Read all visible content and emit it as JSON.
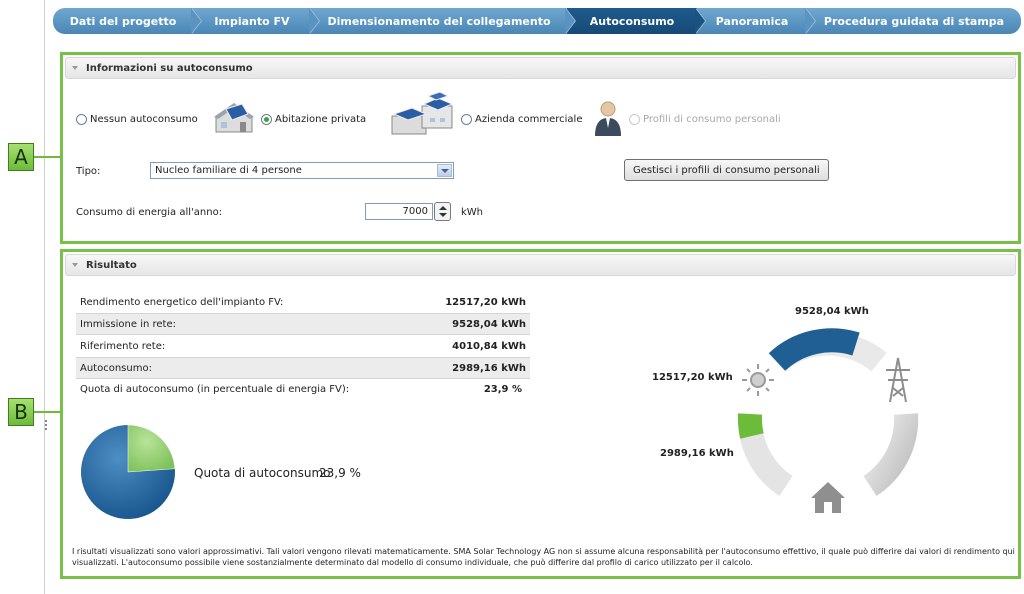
{
  "wizard": {
    "steps": [
      {
        "label": "Dati del progetto"
      },
      {
        "label": "Impianto FV"
      },
      {
        "label": "Dimensionamento del collegamento"
      },
      {
        "label": "Autoconsumo"
      },
      {
        "label": "Panoramica"
      },
      {
        "label": "Procedura guidata di stampa"
      }
    ],
    "active_index": 3
  },
  "callouts": {
    "a": "A",
    "b": "B"
  },
  "info_panel": {
    "title": "Informazioni su autoconsumo",
    "options": {
      "none": "Nessun autoconsumo",
      "private": "Abitazione privata",
      "commercial": "Azienda commerciale",
      "personal": "Profili di consumo personali"
    },
    "selected": "private",
    "tipo_label": "Tipo:",
    "tipo_value": "Nucleo familiare di 4 persone",
    "manage_button": "Gestisci i profili di consumo personali",
    "consumption_label": "Consumo di energia all'anno:",
    "consumption_value": "7000",
    "consumption_unit": "kWh"
  },
  "result_panel": {
    "title": "Risultato",
    "rows": [
      {
        "label": "Rendimento energetico dell'impianto FV:",
        "value": "12517,20 kWh"
      },
      {
        "label": "Immissione in rete:",
        "value": "9528,04 kWh"
      },
      {
        "label": "Riferimento rete:",
        "value": "4010,84 kWh"
      },
      {
        "label": "Autoconsumo:",
        "value": "2989,16 kWh"
      },
      {
        "label": "Quota di autoconsumo (in percentuale di energia FV):",
        "value": "23,9 %"
      }
    ],
    "pie_label": "Quota di autoconsumo",
    "pie_value": "23,9 %",
    "pie_fraction": 0.239,
    "ring": {
      "grid_feed_in": "9528,04 kWh",
      "pv_yield": "12517,20 kWh",
      "self_consumption": "2989,16 kWh"
    },
    "disclaimer": "I risultati visualizzati sono valori approssimativi. Tali valori vengono rilevati matematicamente. SMA Solar Technology AG non si assume alcuna responsabilità per l'autoconsumo effettivo, il quale può differire dai valori di rendimento qui visualizzati. L'autoconsumo possibile viene sostanzialmente determinato dal modello di consumo individuale, che può differire dal profilo di carico utilizzato per il calcolo."
  },
  "colors": {
    "green": "#78c047",
    "blue": "#1f5f94",
    "nav": "#4a86b6",
    "nav_active": "#174a76",
    "gray": "#b8b8b8"
  }
}
